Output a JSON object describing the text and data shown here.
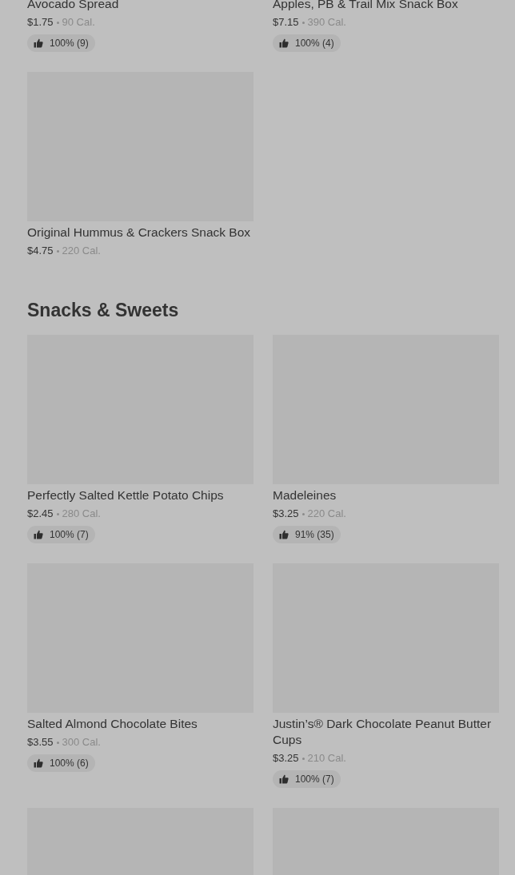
{
  "sections": [
    {
      "items": [
        {
          "kind": "product_cropped",
          "name": "Avocado Spread",
          "price": "$1.75",
          "calories": "90 Cal.",
          "rating": "100% (9)"
        },
        {
          "kind": "product_cropped",
          "name": "Apples, PB & Trail Mix Snack Box",
          "price": "$7.15",
          "calories": "390 Cal.",
          "rating": "100% (4)"
        },
        {
          "kind": "product",
          "name": "Original Hummus & Crackers Snack Box",
          "price": "$4.75",
          "calories": "220 Cal."
        }
      ]
    },
    {
      "title": "Snacks & Sweets",
      "items": [
        {
          "kind": "product",
          "name": "Perfectly Salted Kettle Potato Chips",
          "price": "$2.45",
          "calories": "280 Cal.",
          "rating": "100% (7)"
        },
        {
          "kind": "product",
          "name": "Madeleines",
          "price": "$3.25",
          "calories": "220 Cal.",
          "rating": "91% (35)"
        },
        {
          "kind": "product",
          "name": "Salted Almond Chocolate Bites",
          "price": "$3.55",
          "calories": "300 Cal.",
          "rating": "100% (6)"
        },
        {
          "kind": "product",
          "name": "Justin’s® Dark Chocolate Peanut Butter Cups",
          "price": "$3.25",
          "calories": "210 Cal.",
          "rating": "100% (7)"
        },
        {
          "kind": "image_only"
        },
        {
          "kind": "image_only"
        }
      ]
    }
  ]
}
